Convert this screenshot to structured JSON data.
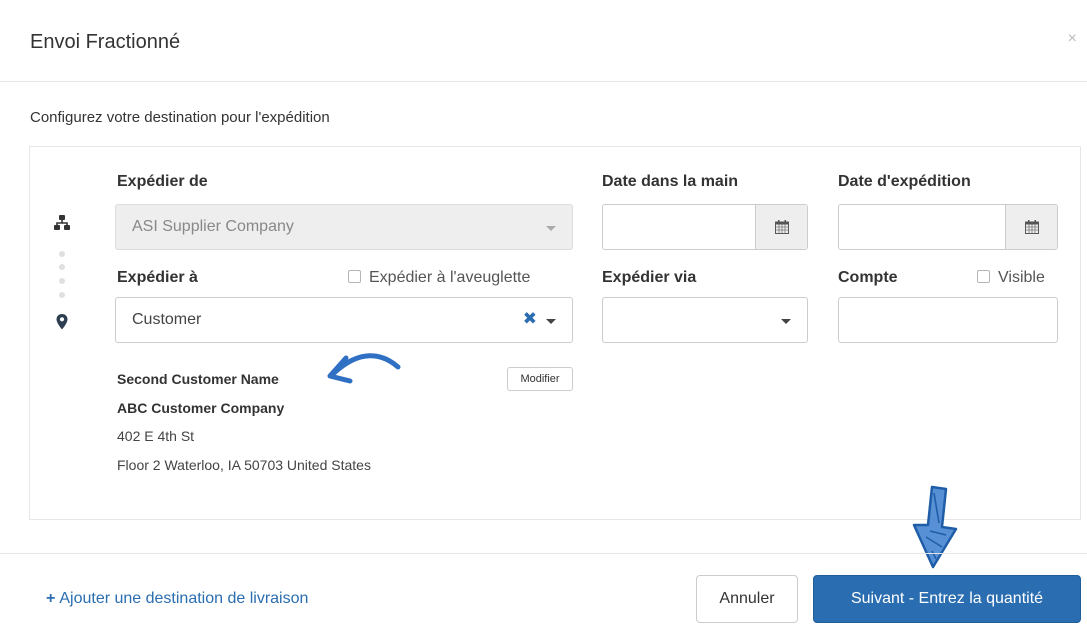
{
  "modal": {
    "title": "Envoi Fractionné",
    "close": "×",
    "subtitle": "Configurez votre destination pour l'expédition"
  },
  "form": {
    "ship_from": {
      "label": "Expédier de",
      "value": "ASI Supplier Company"
    },
    "in_hands_date": {
      "label": "Date dans la main",
      "value": ""
    },
    "ship_date": {
      "label": "Date d'expédition",
      "value": ""
    },
    "ship_to": {
      "label": "Expédier à",
      "value": "Customer"
    },
    "blind_ship": {
      "label": "Expédier à l'aveuglette",
      "checked": false
    },
    "ship_via": {
      "label": "Expédier via",
      "value": ""
    },
    "account": {
      "label": "Compte",
      "value": ""
    },
    "visible": {
      "label": "Visible",
      "checked": false
    }
  },
  "address": {
    "name": "Second Customer Name",
    "company": "ABC Customer Company",
    "line1": "402 E 4th St",
    "line2": "Floor 2 Waterloo, IA 50703 United States",
    "modify_label": "Modifier"
  },
  "footer": {
    "add_destination_label": "Ajouter une destination de livraison",
    "cancel_label": "Annuler",
    "next_label": "Suivant - Entrez la quantité"
  },
  "colors": {
    "primary": "#2a6db0",
    "link": "#2a6db0",
    "annotation": "#2f6fc4"
  },
  "icons": [
    "sitemap-icon",
    "map-marker-icon",
    "calendar-icon",
    "chevron-down-icon",
    "clear-icon",
    "plus-icon",
    "close-icon"
  ]
}
